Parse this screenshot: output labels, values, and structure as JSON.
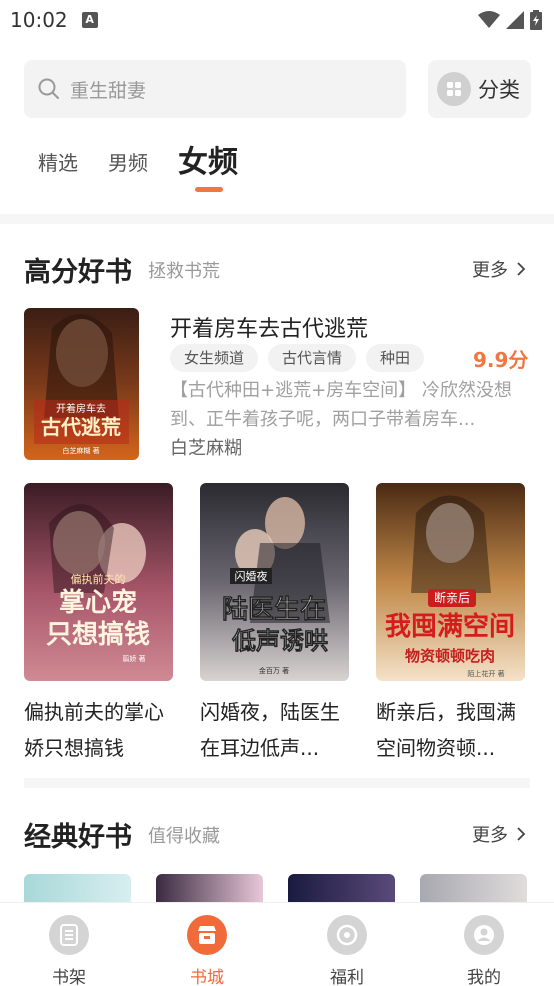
{
  "status": {
    "time": "10:02",
    "notif_badge": "A"
  },
  "search": {
    "placeholder": "重生甜妻"
  },
  "category_button": {
    "label": "分类"
  },
  "tabs": [
    {
      "label": "精选",
      "active": false
    },
    {
      "label": "男频",
      "active": false
    },
    {
      "label": "女频",
      "active": true
    }
  ],
  "section_high": {
    "title": "高分好书",
    "subtitle": "拯救书荒",
    "more": "更多"
  },
  "featured": {
    "title": "开着房车去古代逃荒",
    "tags": [
      "女生频道",
      "古代言情",
      "种田"
    ],
    "score": "9.9分",
    "description": "【古代种田+逃荒+房车空间】 冷欣然没想到、正牛着孩子呢，两口子带着房车...",
    "author": "白芝麻糊",
    "cover_text": "开着房车去古代逃荒",
    "cover_author": "白芝麻糊 著"
  },
  "grid_books": [
    {
      "title": "偏执前夫的掌心娇只想搞钱",
      "cover_top": "偏执前夫的",
      "cover_main": "掌心宠 只想搞钱",
      "cover_author": "翦娇 著"
    },
    {
      "title": "闪婚夜，陆医生在耳边低声...",
      "cover_top": "闪婚夜",
      "cover_main": "陆医生在 低声诱哄",
      "cover_author": "金百万 著"
    },
    {
      "title": "断亲后，我囤满空间物资顿...",
      "cover_top": "断亲后",
      "cover_main": "我囤满空间",
      "cover_sub": "物资顿顿吃肉",
      "cover_author": "陌上花开 著"
    }
  ],
  "section_classic": {
    "title": "经典好书",
    "subtitle": "值得收藏",
    "more": "更多"
  },
  "bottom_nav": [
    {
      "label": "书架",
      "icon": "bookshelf-icon",
      "active": false
    },
    {
      "label": "书城",
      "icon": "bookstore-icon",
      "active": true
    },
    {
      "label": "福利",
      "icon": "gift-icon",
      "active": false
    },
    {
      "label": "我的",
      "icon": "profile-icon",
      "active": false
    }
  ],
  "colors": {
    "accent": "#f07840",
    "nav_active": "#f06a3a"
  }
}
